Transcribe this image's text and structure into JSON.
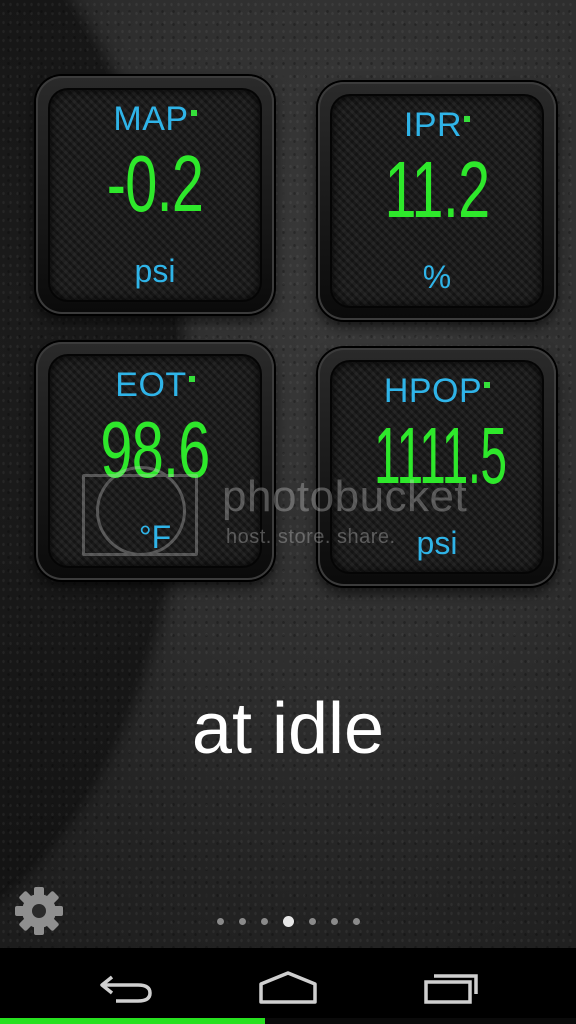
{
  "gauges": [
    {
      "label": "MAP",
      "value": "-0.2",
      "unit": "psi"
    },
    {
      "label": "IPR",
      "value": "11.2",
      "unit": "%"
    },
    {
      "label": "EOT",
      "value": "98.6",
      "unit": "°F"
    },
    {
      "label": "HPOP",
      "value": "1111.5",
      "unit": "psi"
    }
  ],
  "watermark": {
    "name": "photobucket",
    "tagline": "host. store. share."
  },
  "caption": "at idle",
  "pager": {
    "count": 7,
    "active_index": 3
  },
  "navbar": {
    "back_icon": "back-icon",
    "home_icon": "home-icon",
    "recents_icon": "recents-icon"
  },
  "progress": {
    "fraction": 0.46
  },
  "colors": {
    "value_green": "#2ee82b",
    "label_blue": "#2fb4e8",
    "progress_green": "#27e01f"
  }
}
